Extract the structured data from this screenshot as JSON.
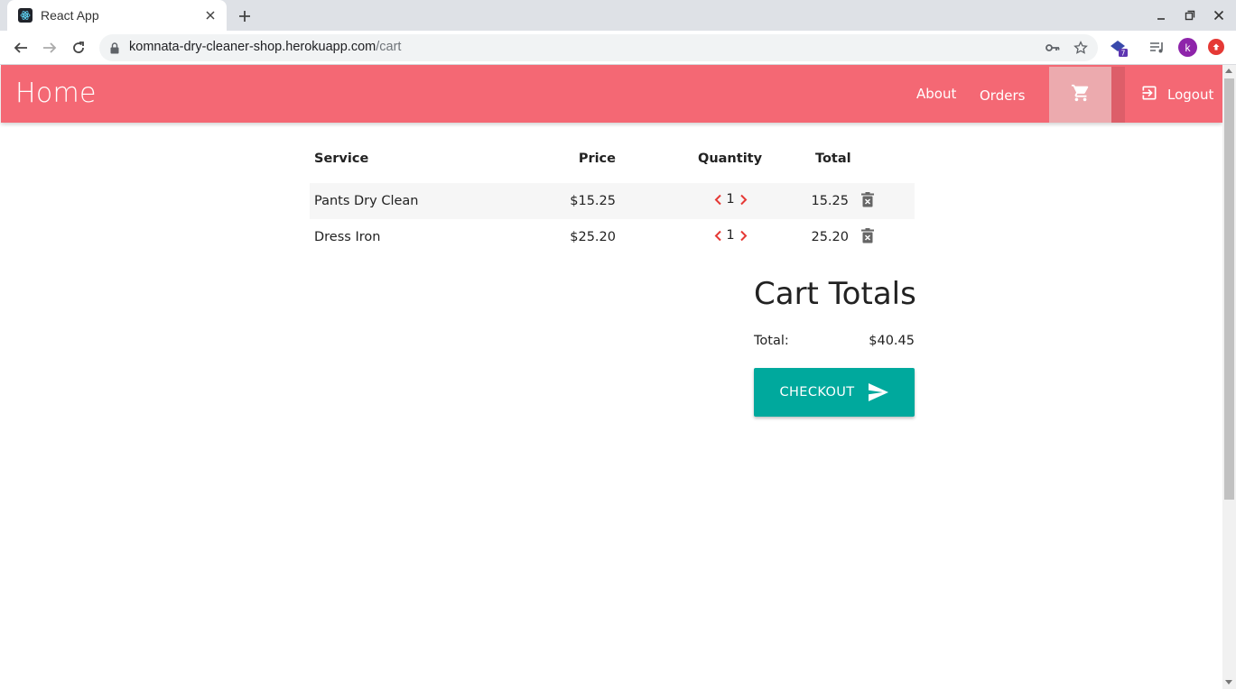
{
  "browser": {
    "tab_title": "React App",
    "url_host": "komnata-dry-cleaner-shop.herokuapp.com",
    "url_path": "/cart",
    "extension_badge": "7",
    "profile_initial": "k"
  },
  "nav": {
    "brand": "Home",
    "links": [
      {
        "label": "About"
      },
      {
        "label": "Orders"
      }
    ],
    "logout_label": "Logout"
  },
  "cart": {
    "headers": {
      "service": "Service",
      "price": "Price",
      "quantity": "Quantity",
      "total": "Total"
    },
    "items": [
      {
        "service": "Pants Dry Clean",
        "price": "$15.25",
        "quantity": "1",
        "total": "15.25"
      },
      {
        "service": "Dress Iron",
        "price": "$25.20",
        "quantity": "1",
        "total": "25.20"
      }
    ]
  },
  "totals": {
    "title": "Cart Totals",
    "label": "Total:",
    "value": "$40.45",
    "checkout_label": "CHECKOUT"
  },
  "colors": {
    "navbar": "#f46874",
    "cart_active": "#ecaaae",
    "checkout": "#00a99d",
    "qty_arrow": "#e53935",
    "delete_icon": "#666666"
  }
}
